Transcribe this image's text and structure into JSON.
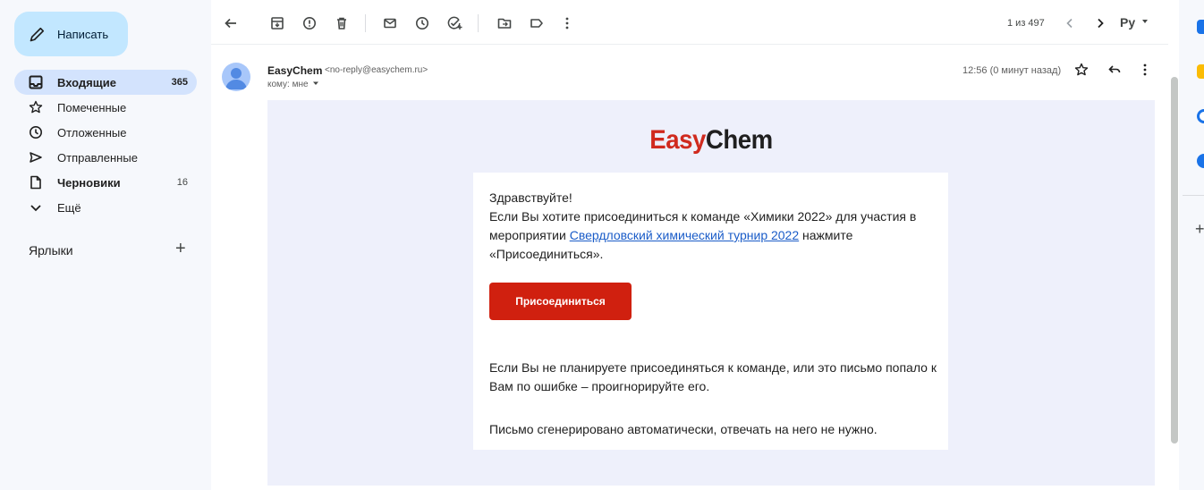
{
  "sidebar": {
    "compose_label": "Написать",
    "items": [
      {
        "label": "Входящие",
        "count": "365"
      },
      {
        "label": "Помеченные",
        "count": ""
      },
      {
        "label": "Отложенные",
        "count": ""
      },
      {
        "label": "Отправленные",
        "count": ""
      },
      {
        "label": "Черновики",
        "count": "16"
      },
      {
        "label": "Ещё",
        "count": ""
      }
    ],
    "labels_title": "Ярлыки",
    "labels_add": "+"
  },
  "toolbar": {
    "pager": "1 из 497",
    "lang": "Py"
  },
  "message": {
    "sender_name": "EasyChem",
    "sender_email": "<no-reply@easychem.ru>",
    "recipient": "кому: мне",
    "time": "12:56 (0 минут назад)"
  },
  "email": {
    "logo_part1": "Easy",
    "logo_part2": "Chem",
    "greeting": "Здравствуйте!",
    "body1_before": "Если Вы хотите присоединиться к команде «Химики 2022» для участия в мероприятии ",
    "body1_link": "Свердловский химический турнир 2022",
    "body1_after": " нажмите «Присоединиться».",
    "join_button": "Присоединиться",
    "body2": "Если Вы не планируете присоединяться к команде, или это письмо попало к Вам по ошибке – проигнорируйте его.",
    "auto_note": "Письмо сгенерировано автоматически, отвечать на него не нужно."
  },
  "colors": {
    "brand_red": "#d02a1e",
    "compose_bg": "#c2e7ff",
    "active_nav_bg": "#d3e3fd",
    "email_bg": "#eef0fb"
  }
}
